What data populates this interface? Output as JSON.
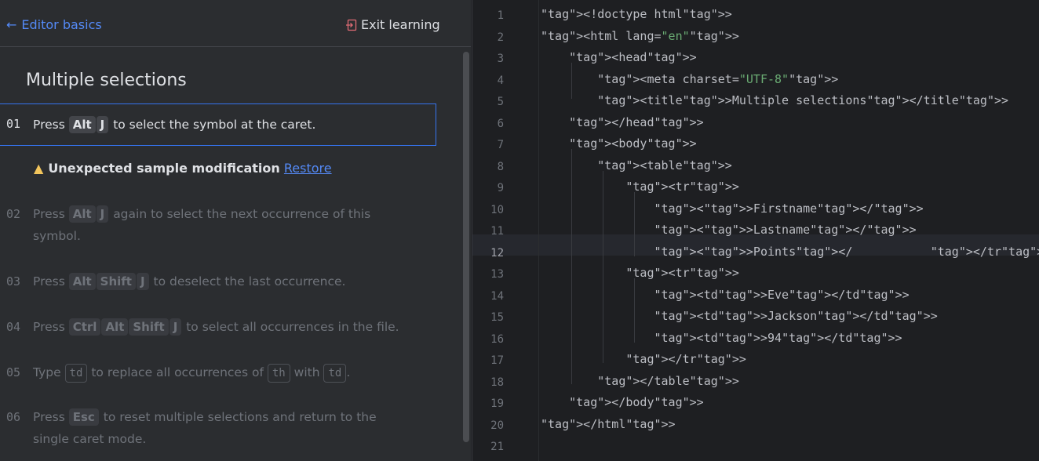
{
  "learning": {
    "back_label": "Editor basics",
    "exit_label": "Exit learning",
    "title": "Multiple selections",
    "active_step": {
      "num": "01",
      "pre": "Press",
      "keys": [
        "Alt",
        "J"
      ],
      "post": "to select the symbol at the caret."
    },
    "warning": {
      "text": "Unexpected sample modification",
      "link": "Restore"
    },
    "steps": [
      {
        "num": "02",
        "pre": "Press",
        "keys": [
          "Alt",
          "J"
        ],
        "post": "again to select the next occurrence of this symbol."
      },
      {
        "num": "03",
        "pre": "Press",
        "keys": [
          "Alt",
          "Shift",
          "J"
        ],
        "post": "to deselect the last occurrence."
      },
      {
        "num": "04",
        "pre": "Press",
        "keys": [
          "Ctrl",
          "Alt",
          "Shift",
          "J"
        ],
        "post": "to select all occurrences in the file."
      },
      {
        "num": "05",
        "pre": "Type",
        "code1": "td",
        "mid": "to replace all occurrences of",
        "code2": "th",
        "mid2": "with",
        "code3": "td",
        "post": "."
      },
      {
        "num": "06",
        "pre": "Press",
        "keys": [
          "Esc"
        ],
        "post": "to reset multiple selections and return to the single caret mode."
      }
    ]
  },
  "editor": {
    "current_line": 12,
    "lines": [
      "<!doctype html>",
      "<html lang=\"en\">",
      "    <head>",
      "        <meta charset=\"UTF-8\">",
      "        <title>Multiple selections</title>",
      "    </head>",
      "    <body>",
      "        <table>",
      "            <tr>",
      "                <>Firstname</>",
      "                <>Lastname</>",
      "                <>Points</           </tr>",
      "            <tr>",
      "                <td>Eve</td>",
      "                <td>Jackson</td>",
      "                <td>94</td>",
      "            </tr>",
      "        </table>",
      "    </body>",
      "</html>",
      ""
    ]
  },
  "colors": {
    "accent": "#548af7",
    "tag": "#d5b778",
    "string": "#6aab73",
    "warning": "#f2c55c",
    "error_underline": "#f75464"
  }
}
